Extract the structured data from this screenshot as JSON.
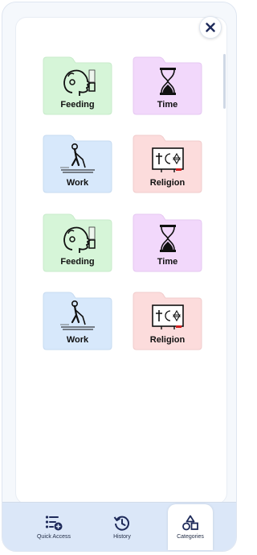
{
  "colors": {
    "feeding": "#d6f5d8",
    "time": "#f2d8fb",
    "work": "#d7e8fb",
    "religion": "#fcdcdc",
    "accent": "#1e2a5a",
    "nav_bg": "#dbe7f8"
  },
  "tiles": [
    {
      "label": "Feeding",
      "icon": "feeding-icon"
    },
    {
      "label": "Time",
      "icon": "hourglass-icon"
    },
    {
      "label": "Work",
      "icon": "work-icon"
    },
    {
      "label": "Religion",
      "icon": "religion-icon"
    },
    {
      "label": "Feeding",
      "icon": "feeding-icon"
    },
    {
      "label": "Time",
      "icon": "hourglass-icon"
    },
    {
      "label": "Work",
      "icon": "work-icon"
    },
    {
      "label": "Religion",
      "icon": "religion-icon"
    }
  ],
  "nav": {
    "quick_access": "Quick Access",
    "history": "History",
    "categories": "Categories"
  },
  "close_icon": "close-icon"
}
